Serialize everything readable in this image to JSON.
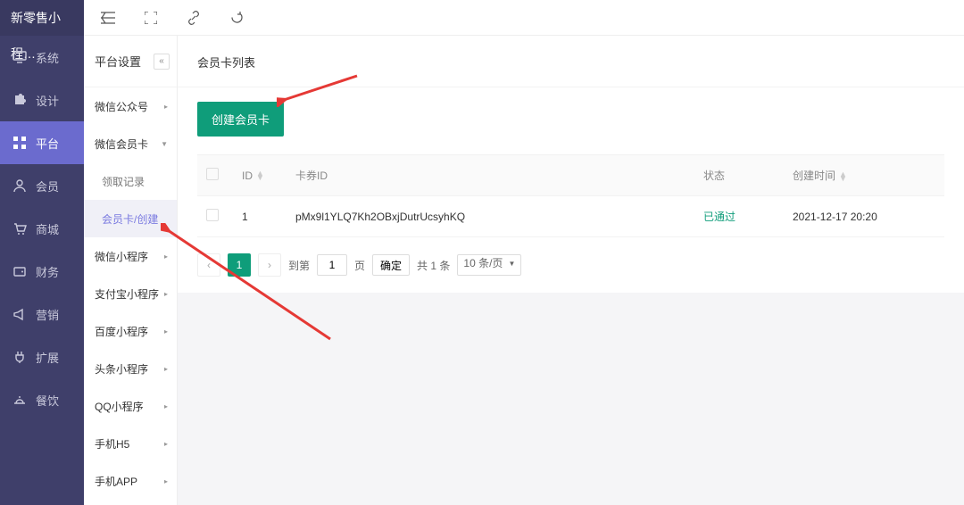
{
  "brand": "新零售小程…",
  "main_nav": [
    {
      "label": "系统",
      "icon": "monitor"
    },
    {
      "label": "设计",
      "icon": "puzzle"
    },
    {
      "label": "平台",
      "icon": "grid"
    },
    {
      "label": "会员",
      "icon": "user"
    },
    {
      "label": "商城",
      "icon": "cart"
    },
    {
      "label": "财务",
      "icon": "wallet"
    },
    {
      "label": "营销",
      "icon": "horn"
    },
    {
      "label": "扩展",
      "icon": "plug"
    },
    {
      "label": "餐饮",
      "icon": "dish"
    }
  ],
  "main_nav_active_index": 2,
  "sub_nav": {
    "header": "平台设置",
    "items": [
      {
        "label": "微信公众号",
        "type": "group"
      },
      {
        "label": "微信会员卡",
        "type": "group",
        "expanded": true
      },
      {
        "label": "领取记录",
        "type": "child"
      },
      {
        "label": "会员卡/创建",
        "type": "child",
        "selected": true
      },
      {
        "label": "微信小程序",
        "type": "group"
      },
      {
        "label": "支付宝小程序",
        "type": "group"
      },
      {
        "label": "百度小程序",
        "type": "group"
      },
      {
        "label": "头条小程序",
        "type": "group"
      },
      {
        "label": "QQ小程序",
        "type": "group"
      },
      {
        "label": "手机H5",
        "type": "group"
      },
      {
        "label": "手机APP",
        "type": "group"
      }
    ]
  },
  "panel": {
    "title": "会员卡列表",
    "create_button": "创建会员卡"
  },
  "table": {
    "columns": {
      "id": "ID",
      "card_id": "卡券ID",
      "status": "状态",
      "created": "创建时间"
    },
    "rows": [
      {
        "id": "1",
        "card_id": "pMx9l1YLQ7Kh2OBxjDutrUcsyhKQ",
        "status": "已通过",
        "created": "2021-12-17 20:20"
      }
    ]
  },
  "pager": {
    "current": "1",
    "goto_label_prefix": "到第",
    "goto_value": "1",
    "goto_label_suffix": "页",
    "confirm": "确定",
    "total": "共 1 条",
    "per_page": "10 条/页"
  },
  "colors": {
    "primary": "#0f9d7a",
    "sidebar": "#3f3f6a",
    "nav_active": "#6b6bce"
  }
}
